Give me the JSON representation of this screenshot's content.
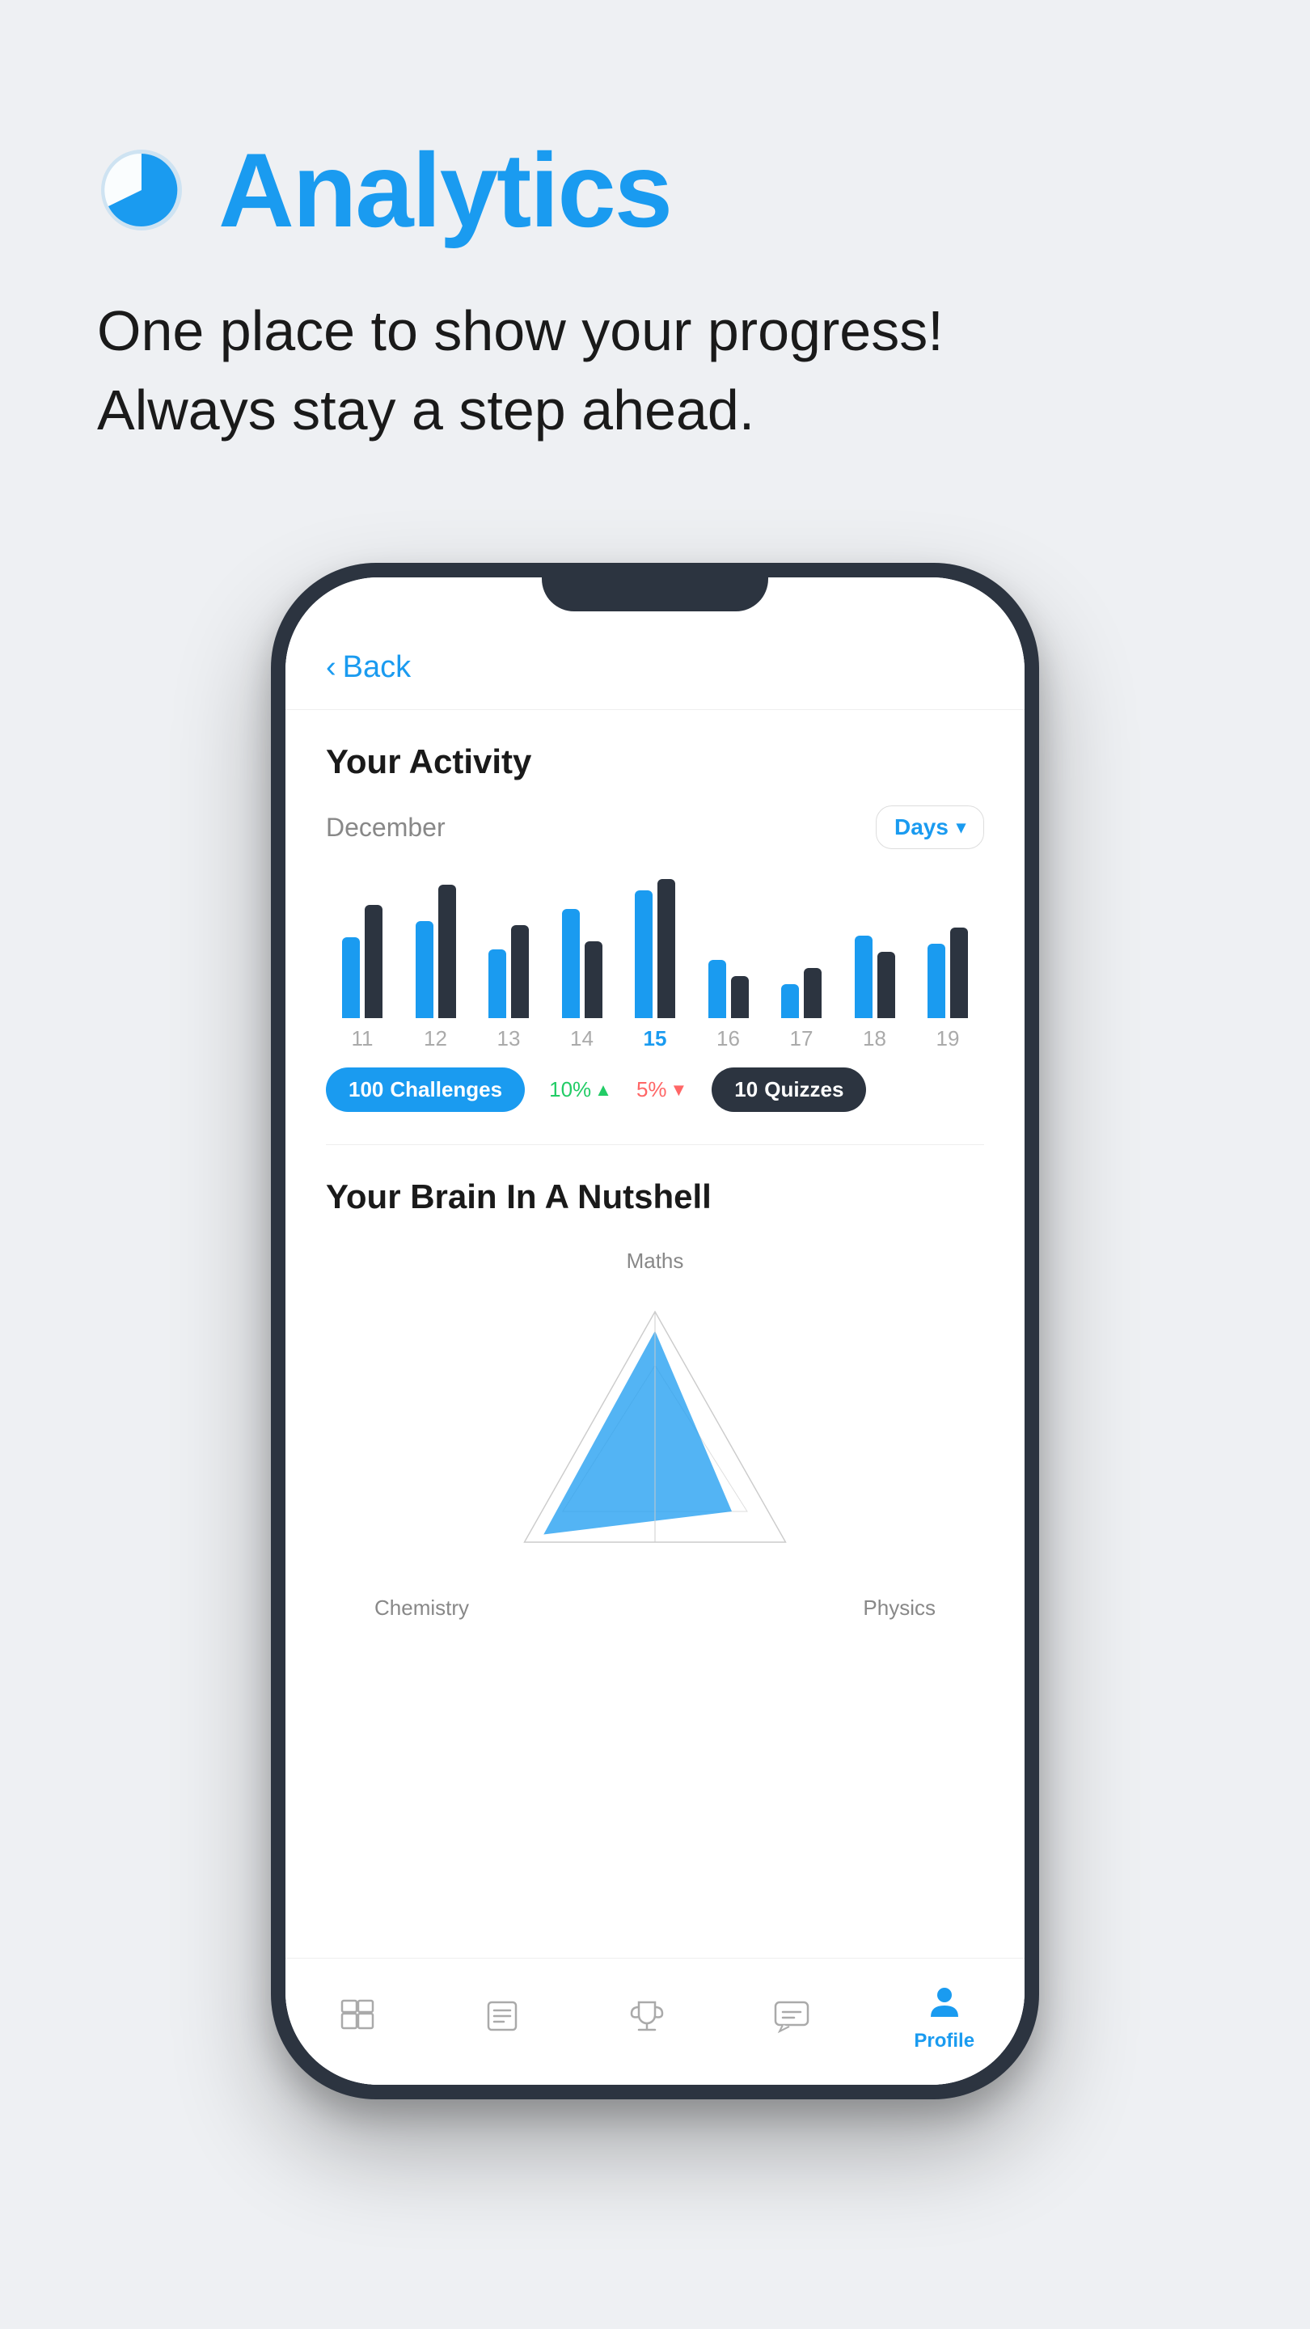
{
  "header": {
    "title": "Analytics",
    "icon_name": "analytics-icon",
    "subtitle_line1": "One place to show your progress!",
    "subtitle_line2": "Always stay a step ahead."
  },
  "phone": {
    "back_label": "Back",
    "screen": {
      "activity_section": {
        "title": "Your Activity",
        "month": "December",
        "dropdown_label": "Days",
        "bars": [
          {
            "day": "11",
            "bar1_height": 100,
            "bar2_height": 140,
            "active": false
          },
          {
            "day": "12",
            "bar1_height": 120,
            "bar2_height": 160,
            "active": false
          },
          {
            "day": "13",
            "bar1_height": 80,
            "bar2_height": 110,
            "active": false
          },
          {
            "day": "14",
            "bar1_height": 130,
            "bar2_height": 90,
            "active": false
          },
          {
            "day": "15",
            "bar1_height": 155,
            "bar2_height": 170,
            "active": true
          },
          {
            "day": "16",
            "bar1_height": 70,
            "bar2_height": 50,
            "active": false
          },
          {
            "day": "17",
            "bar1_height": 40,
            "bar2_height": 60,
            "active": false
          },
          {
            "day": "18",
            "bar1_height": 100,
            "bar2_height": 80,
            "active": false
          },
          {
            "day": "19",
            "bar1_height": 90,
            "bar2_height": 110,
            "active": false
          }
        ],
        "stats": {
          "challenges_count": "100",
          "challenges_label": "Challenges",
          "percent1": "10%",
          "percent1_direction": "up",
          "percent2": "5%",
          "percent2_direction": "down",
          "quizzes_count": "10",
          "quizzes_label": "Quizzes"
        }
      },
      "brain_section": {
        "title": "Your Brain In A Nutshell",
        "labels": {
          "top": "Maths",
          "bottom_left": "Chemistry",
          "bottom_right": "Physics"
        }
      },
      "bottom_nav": {
        "items": [
          {
            "name": "home",
            "label": "",
            "active": false
          },
          {
            "name": "lessons",
            "label": "",
            "active": false
          },
          {
            "name": "trophy",
            "label": "",
            "active": false
          },
          {
            "name": "chat",
            "label": "",
            "active": false
          },
          {
            "name": "profile",
            "label": "Profile",
            "active": true
          }
        ]
      }
    }
  },
  "colors": {
    "accent": "#1a9bf0",
    "dark": "#2c3440",
    "bg": "#eef0f3",
    "green": "#22cc66",
    "red": "#ff6666"
  }
}
